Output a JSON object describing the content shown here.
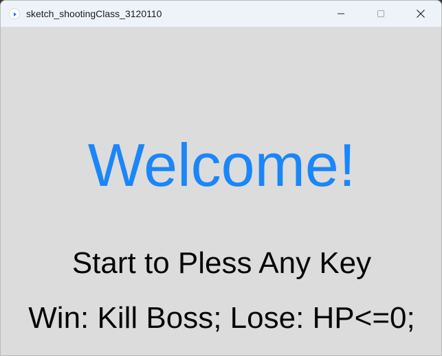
{
  "window": {
    "title": "sketch_shootingClass_3120110",
    "app_icon": "processing-play-icon",
    "controls": {
      "minimize": "minimize-icon",
      "maximize": "maximize-icon",
      "close": "close-icon"
    }
  },
  "screen": {
    "headline": "Welcome!",
    "prompt": "Start to Pless Any Key",
    "rules": "Win: Kill Boss; Lose: HP<=0;"
  },
  "colors": {
    "background": "#dcdcdc",
    "headline": "#1a86f8",
    "text": "#050505",
    "titlebar": "#eef3fa"
  }
}
